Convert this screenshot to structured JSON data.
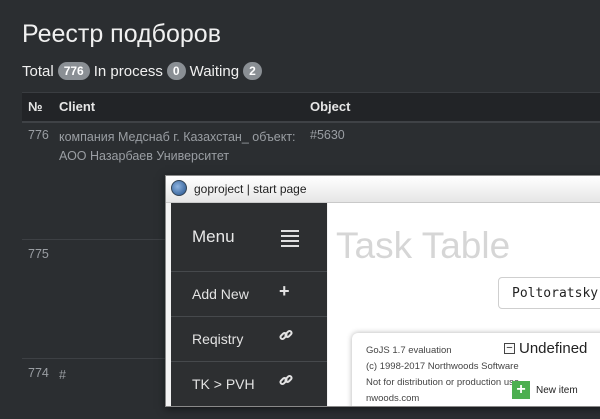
{
  "page": {
    "title": "Реестр подборов"
  },
  "stats": {
    "total_label": "Total",
    "total": "776",
    "in_process_label": "In process",
    "in_process": "0",
    "waiting_label": "Waiting",
    "waiting": "2"
  },
  "table": {
    "headers": {
      "num": "№",
      "client": "Client",
      "object": "Object"
    },
    "rows": [
      {
        "num": "776",
        "client": "компания Медснаб г. Казахстан_ объект: АОО Назарбаев Университет",
        "object": "#5630"
      },
      {
        "num": "775",
        "client": "",
        "object": ""
      },
      {
        "num": "774",
        "client": "#",
        "object": ""
      }
    ]
  },
  "window": {
    "title": "goproject | start page",
    "icon": "globe-icon",
    "menu": {
      "label": "Menu",
      "items": [
        {
          "label": "Add New",
          "icon": "plus-icon"
        },
        {
          "label": "Reqistry",
          "icon": "link-icon"
        },
        {
          "label": "TK > PVH",
          "icon": "link-icon"
        }
      ]
    },
    "content": {
      "title": "Task Table",
      "select_value": "Poltoratsky",
      "watermark": [
        "GoJS 1.7 evaluation",
        "(c) 1998-2017 Northwoods Software",
        "Not for distribution or production use",
        "nwoods.com"
      ],
      "group_label": "Undefined",
      "new_item_label": "New item"
    }
  },
  "colors": {
    "background": "#2b2e31",
    "sidebar": "#2d2f31",
    "new_item_green": "#4caf50"
  }
}
